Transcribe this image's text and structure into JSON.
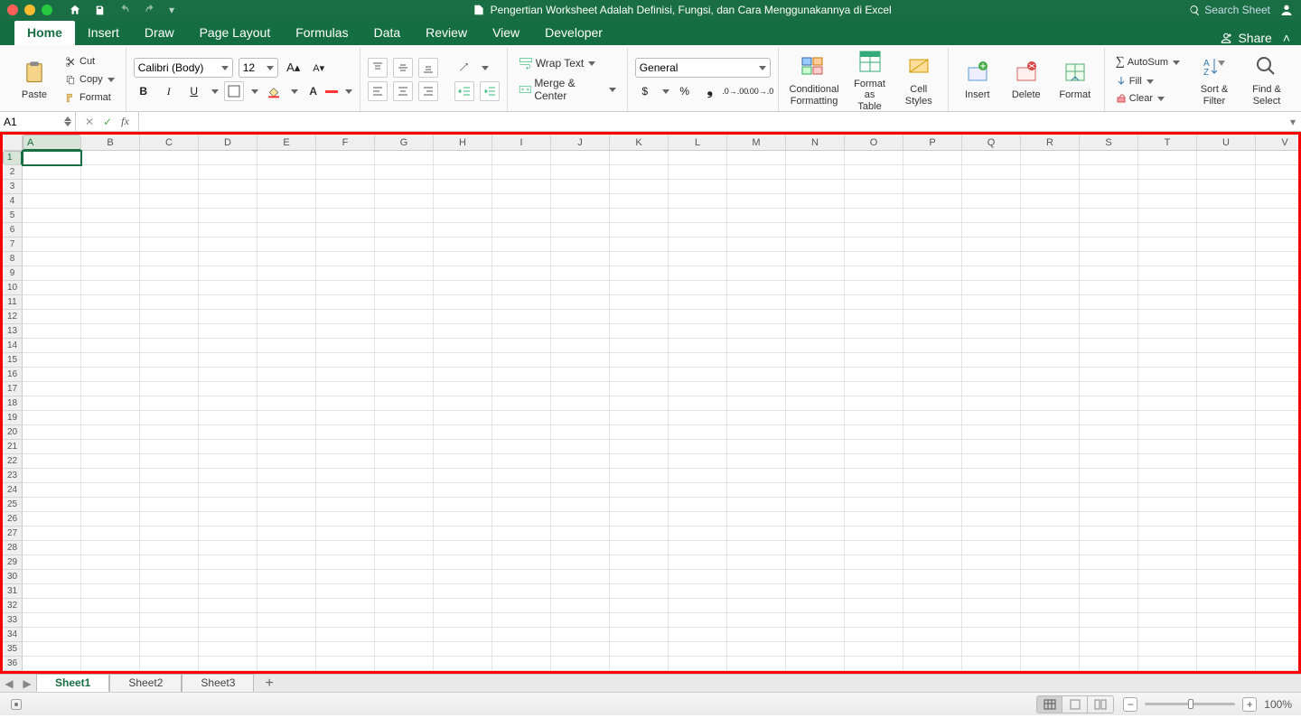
{
  "titlebar": {
    "doc_title": "Pengertian Worksheet Adalah Definisi, Fungsi, dan Cara Menggunakannya di Excel",
    "search_placeholder": "Search Sheet"
  },
  "tabs": {
    "items": [
      "Home",
      "Insert",
      "Draw",
      "Page Layout",
      "Formulas",
      "Data",
      "Review",
      "View",
      "Developer"
    ],
    "active": "Home",
    "share_label": "Share"
  },
  "ribbon": {
    "clipboard": {
      "paste": "Paste",
      "cut": "Cut",
      "copy": "Copy",
      "format": "Format"
    },
    "font": {
      "name": "Calibri (Body)",
      "size": "12"
    },
    "alignment": {
      "wrap": "Wrap Text",
      "merge": "Merge & Center"
    },
    "number": {
      "format": "General"
    },
    "styles": {
      "cond": "Conditional\nFormatting",
      "table": "Format\nas Table",
      "cell": "Cell\nStyles"
    },
    "cells": {
      "insert": "Insert",
      "delete": "Delete",
      "format": "Format"
    },
    "editing": {
      "autosum": "AutoSum",
      "fill": "Fill",
      "clear": "Clear",
      "sort": "Sort &\nFilter",
      "find": "Find &\nSelect"
    }
  },
  "formula_bar": {
    "namebox": "A1",
    "formula": ""
  },
  "grid": {
    "columns": [
      "A",
      "B",
      "C",
      "D",
      "E",
      "F",
      "G",
      "H",
      "I",
      "J",
      "K",
      "L",
      "M",
      "N",
      "O",
      "P",
      "Q",
      "R",
      "S",
      "T",
      "U",
      "V"
    ],
    "rows": 36,
    "active_cell": "A1"
  },
  "sheets": {
    "tabs": [
      "Sheet1",
      "Sheet2",
      "Sheet3"
    ],
    "active": "Sheet1"
  },
  "status": {
    "zoom": "100%"
  }
}
